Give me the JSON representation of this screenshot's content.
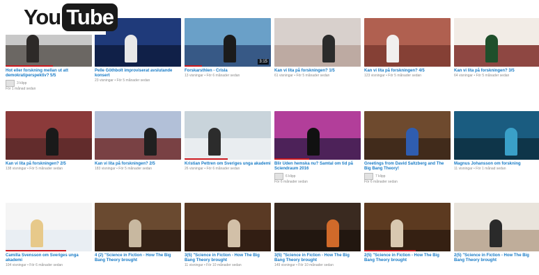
{
  "brand": {
    "you": "You",
    "tube": "Tube"
  },
  "videos": [
    {
      "title": "Hot eller forskning mellan ut att demokratiperspektiv? 5/5",
      "meta": "",
      "duration": "",
      "playlist_count": "3 klipp",
      "playlist_time": "För 1 månad sedan",
      "thumb": {
        "bg1": "#c8c8c8",
        "bg2": "#5b5651",
        "fig": "#2d2a28"
      },
      "progress": 0.55
    },
    {
      "title": "Pelle Göthbolt improviserat avslutande konsert",
      "meta": "23 visningar • För 5 månader sedan",
      "duration": "",
      "thumb": {
        "bg1": "#1f3a7a",
        "bg2": "#0e1c3f",
        "fig": "#e8e8e8"
      },
      "progress": 0
    },
    {
      "title": "Forskarsthlen - Crisla",
      "meta": "13 visningar • För 6 månader sedan",
      "duration": "3:15",
      "thumb": {
        "bg1": "#6aa0c8",
        "bg2": "#2e4c7a",
        "fig": "#1b1b1b"
      },
      "progress": 0.2
    },
    {
      "title": "Kan vi lita på forskningen? 1/5",
      "meta": "61 visningar • För 5 månader sedan",
      "duration": "",
      "thumb": {
        "bg1": "#d8d0cc",
        "bg2": "#b9a39a",
        "fig": "#2b2b2b"
      },
      "progress": 0
    },
    {
      "title": "Kan vi lita på forskningen? 4/5",
      "meta": "123 visningar • För 5 månader sedan",
      "duration": "",
      "thumb": {
        "bg1": "#b06050",
        "bg2": "#7e3b30",
        "fig": "#f1efee"
      },
      "progress": 0
    },
    {
      "title": "Kan vi lita på forskningen? 3/5",
      "meta": "64 visningar • För 5 månader sedan",
      "duration": "",
      "thumb": {
        "bg1": "#f2ece6",
        "bg2": "#7d2a24",
        "fig": "#1f4f2b"
      },
      "progress": 0
    },
    {
      "title": "Kan vi lita på forskningen? 2/5",
      "meta": "138 visningar • För 5 månader sedan",
      "duration": "",
      "thumb": {
        "bg1": "#8b3a3a",
        "bg2": "#5a2a2a",
        "fig": "#1a1a1a"
      },
      "progress": 0
    },
    {
      "title": "Kan vi lita på forskningen? 2/5",
      "meta": "183 visningar • För 5 månader sedan",
      "duration": "",
      "thumb": {
        "bg1": "#b2c0d8",
        "bg2": "#6e2a2a",
        "fig": "#202020"
      },
      "progress": 0
    },
    {
      "title": "Kristian Pettren om Sveriges unga akademi",
      "meta": "26 visningar • För 6 månader sedan",
      "duration": "",
      "thumb": {
        "bg1": "#c9d4db",
        "bg2": "#eef1f3",
        "fig": "#2c2c2c"
      },
      "progress": 0.5
    },
    {
      "title": "Blir Uden hemska nu? Samtal om tid på Sciendraum 2016",
      "meta": "",
      "duration": "",
      "playlist_count": "6 klipp",
      "playlist_time": "För 6 månader sedan",
      "thumb": {
        "bg1": "#b23e9a",
        "bg2": "#3b1d4d",
        "fig": "#111"
      },
      "progress": 0.4
    },
    {
      "title": "Greetings from David Saltzberg and The Big Bang Theory!",
      "meta": "",
      "duration": "",
      "playlist_count": "7 klipp",
      "playlist_time": "För 6 månader sedan",
      "thumb": {
        "bg1": "#6e4a2e",
        "bg2": "#3a2618",
        "fig": "#2f5db0"
      },
      "progress": 0
    },
    {
      "title": "Magnus Johansson om forskning",
      "meta": "11 visningar • För 1 månad sedan",
      "duration": "",
      "thumb": {
        "bg1": "#1a5c80",
        "bg2": "#0d2e40",
        "fig": "#3aa0c8"
      },
      "progress": 0
    },
    {
      "title": "Camilla Svensson om Sveriges unga akademi",
      "meta": "104 visningar • För 6 månader sedan",
      "duration": "",
      "thumb": {
        "bg1": "#f5f5f5",
        "bg2": "#e6ecf2",
        "fig": "#e7c98a"
      },
      "progress": 0.7
    },
    {
      "title": "4 (2) \"Science in Fiction - How The Big Bang Theory brought",
      "meta": "",
      "duration": "",
      "thumb": {
        "bg1": "#6a4a30",
        "bg2": "#2a1a10",
        "fig": "#c8b8a0"
      },
      "progress": 0
    },
    {
      "title": "3(5) \"Science in Fiction - How The Big Bang Theory brought",
      "meta": "11 visningar • För 10 månader sedan",
      "duration": "",
      "thumb": {
        "bg1": "#5a3a24",
        "bg2": "#2b1a10",
        "fig": "#d2c0a8"
      },
      "progress": 0
    },
    {
      "title": "3(5) \"Science in Fiction - How The Big Bang Theory brought",
      "meta": "149 visningar • För 10 månader sedan",
      "duration": "",
      "thumb": {
        "bg1": "#3a2a20",
        "bg2": "#1e140e",
        "fig": "#d06a2a"
      },
      "progress": 0
    },
    {
      "title": "2(5) \"Science in Fiction - How The Big Bang Theory brought",
      "meta": "",
      "duration": "",
      "thumb": {
        "bg1": "#5c3a20",
        "bg2": "#2e1c10",
        "fig": "#d8c8b0"
      },
      "progress": 0.6
    },
    {
      "title": "2(5) \"Science in Fiction - How The Big Bang Theory brought",
      "meta": "",
      "duration": "",
      "thumb": {
        "bg1": "#e9e4dc",
        "bg2": "#b7a38e",
        "fig": "#2a2a2a"
      },
      "progress": 0
    }
  ]
}
